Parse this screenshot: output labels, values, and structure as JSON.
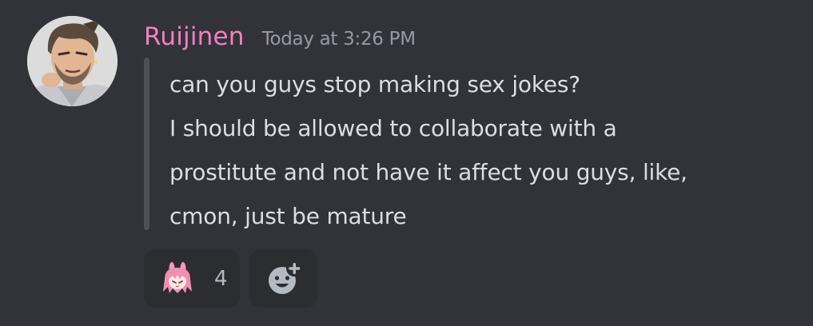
{
  "message": {
    "author": {
      "name": "Ruijinen",
      "name_color": "#f47fc2",
      "avatar_icon": "avatar-image"
    },
    "timestamp": "Today at 3:26 PM",
    "quote_lines": [
      "can you guys stop making sex jokes?",
      "I should be allowed to collaborate with a",
      "prostitute and not have it affect you guys, like,",
      "cmon, just be mature"
    ]
  },
  "reactions": [
    {
      "emoji_icon": "pink-haired-character-emoji",
      "count": "4"
    }
  ],
  "add_reaction_icon": "add-reaction-icon",
  "colors": {
    "background": "#313338",
    "text": "#dbdee1",
    "muted": "#949ba4",
    "quote_bar": "#4e5058",
    "reaction_bg": "#2b2d31"
  }
}
